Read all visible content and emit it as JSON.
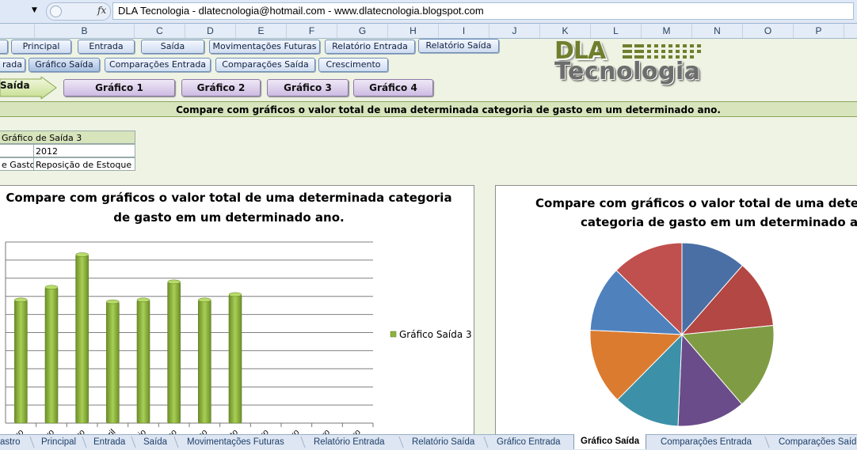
{
  "formula_bar": {
    "name_box_arrow": "▼",
    "fx_label": "fx",
    "content": "DLA Tecnologia - dlatecnologia@hotmail.com - www.dlatecnologia.blogspot.com"
  },
  "columns": [
    "B",
    "C",
    "D",
    "E",
    "F",
    "G",
    "H",
    "I",
    "J",
    "K",
    "L",
    "M",
    "N",
    "O",
    "P"
  ],
  "nav_row1": [
    "Principal",
    "Entrada",
    "Saída",
    "Movimentações Futuras",
    "Relatório Entrada",
    "Relatório Saída"
  ],
  "nav_row2": [
    "rada",
    "Gráfico Saída",
    "Comparações Entrada",
    "Comparações Saída",
    "Crescimento"
  ],
  "arrow_label": "Saída",
  "graph_buttons": [
    "Gráfico 1",
    "Gráfico 2",
    "Gráfico 3",
    "Gráfico 4"
  ],
  "logo": {
    "line1": "DLA",
    "line2": "Tecnologia"
  },
  "banner": "Compare com gráficos o valor total de uma determinada categoria de gasto em um determinado ano.",
  "info_table": {
    "title": "Gráfico de Saída 3",
    "row2_label": "",
    "row2_value": "2012",
    "row3_label": "e Gasto",
    "row3_value": "Reposição de Estoque"
  },
  "bar_chart_title_line1": "Compare com gráficos o valor total de uma determinada categoria",
  "bar_chart_title_line2": "de gasto em um determinado ano.",
  "pie_chart_title_line1": "Compare com gráficos o valor total de uma determi",
  "pie_chart_title_line2": "categoria de gasto em um determinado ano.",
  "chart_data": [
    {
      "type": "bar",
      "title": "Compare com gráficos o valor total de uma determinada categoria de gasto em um determinado ano.",
      "categories": [
        "Janeiro",
        "Fevereiro",
        "Março",
        "Abril",
        "Maio",
        "Junho",
        "Julho",
        "Agosto",
        "Setembro",
        "Outubro",
        "Novembro",
        "Dezembro"
      ],
      "series": [
        {
          "name": "Gráfico Saída 3",
          "values": [
            6.8,
            7.5,
            9.3,
            6.7,
            6.8,
            7.8,
            6.8,
            7.1,
            0,
            0,
            0,
            0
          ]
        }
      ],
      "ylim": [
        0,
        10
      ],
      "grid": true,
      "legend": "right",
      "color": "#8db33f"
    },
    {
      "type": "pie",
      "title": "Compare com gráficos o valor total de uma determinada categoria de gasto em um determinado ano.",
      "values": [
        8.3,
        8.7,
        11.1,
        8.7,
        8.5,
        9.7,
        8.4,
        9.2
      ],
      "colors": [
        "#4a6fa5",
        "#b34744",
        "#7f9c44",
        "#6b4c8a",
        "#3c91a8",
        "#db7b2f",
        "#4f81bd",
        "#c0504d"
      ]
    }
  ],
  "sheet_tabs": [
    "astro",
    "Principal",
    "Entrada",
    "Saída",
    "Movimentações Futuras",
    "Relatório Entrada",
    "Relatório Saída",
    "Gráfico Entrada",
    "Gráfico Saída",
    "Comparações Entrada",
    "Comparações Saíd"
  ],
  "active_tab": "Gráfico Saída"
}
